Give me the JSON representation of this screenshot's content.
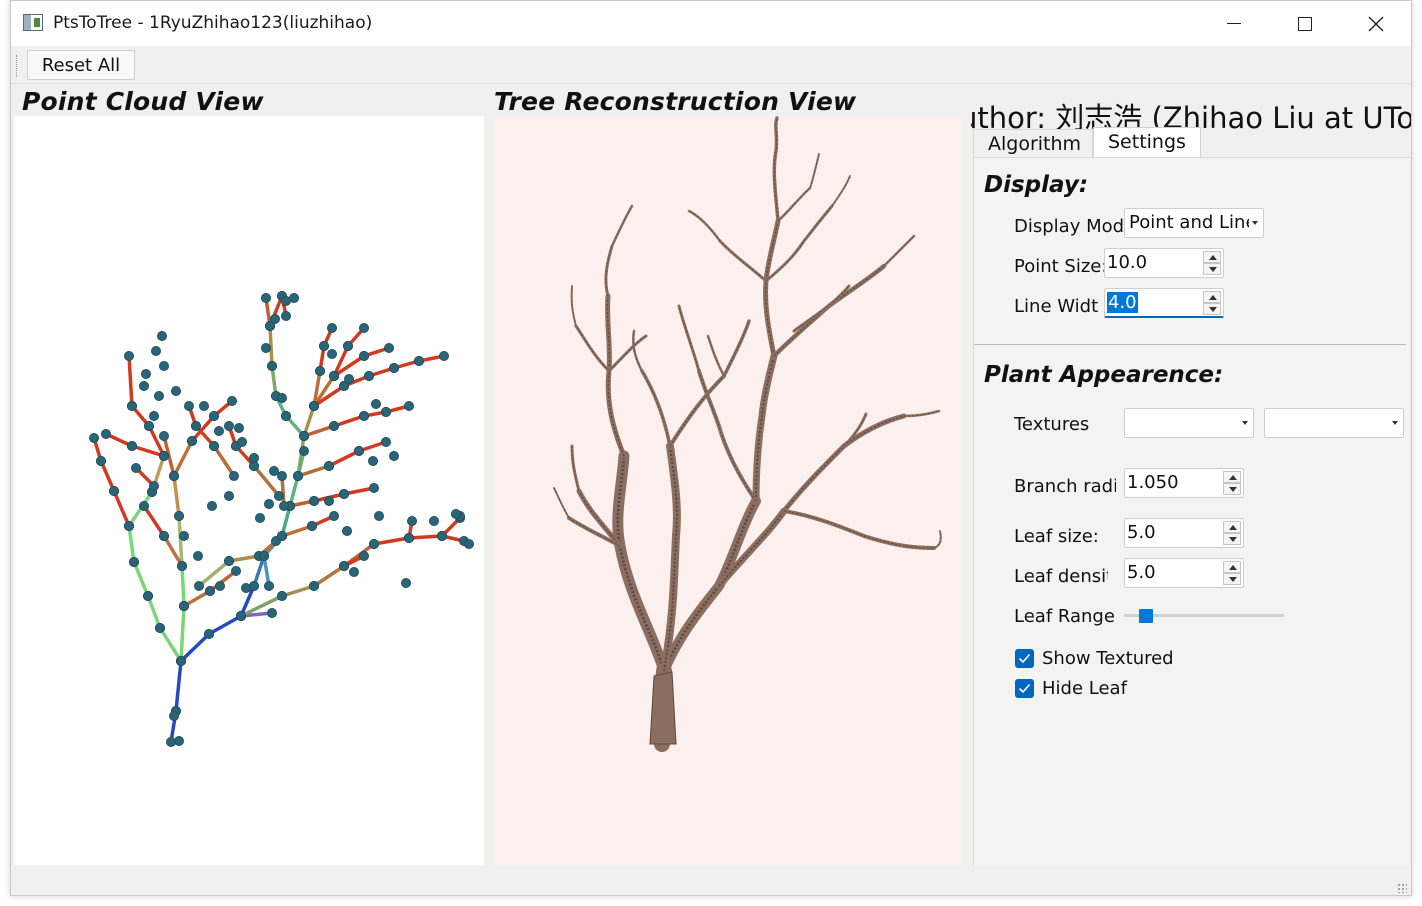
{
  "window": {
    "title": "PtsToTree - 1RyuZhihao123(liuzhihao)"
  },
  "toolbar": {
    "reset_label": "Reset All"
  },
  "views": {
    "point_cloud_title": "Point Cloud View",
    "tree_title": "Tree Reconstruction View"
  },
  "panel": {
    "author": "uthor: 刘志浩 (Zhihao Liu at UToky",
    "tabs": [
      {
        "label": "Algorithm",
        "active": false
      },
      {
        "label": "Settings",
        "active": true
      }
    ],
    "display": {
      "heading": "Display:",
      "display_mode_label": "Display Mode",
      "display_mode_value": "Point and Line",
      "point_size_label": "Point Size:",
      "point_size_value": "10.0",
      "line_width_label": "Line Width",
      "line_width_value": "4.0"
    },
    "plant": {
      "heading": "Plant Appearence:",
      "textures_label": "Textures",
      "texture_combo_1": "",
      "texture_combo_2": "",
      "branch_radius_label": "Branch radius",
      "branch_radius_value": "1.050",
      "leaf_size_label": "Leaf size:",
      "leaf_size_value": "5.0",
      "leaf_density_label": "Leaf density",
      "leaf_density_value": "5.0",
      "leaf_range_label": "Leaf Range:",
      "leaf_range_level": 0.14,
      "show_textured_label": "Show Textured Leaf",
      "show_textured_checked": true,
      "hide_leaf_label": "Hide Leaf",
      "hide_leaf_checked": true
    }
  },
  "colors": {
    "accent": "#0078d7",
    "tree_bg": "#fcf0ef",
    "node": "#2a6478",
    "branch_red": "#d23a20",
    "branch_green": "#78d878",
    "branch_blue": "#2848c0",
    "bark": "#8a6e60"
  }
}
